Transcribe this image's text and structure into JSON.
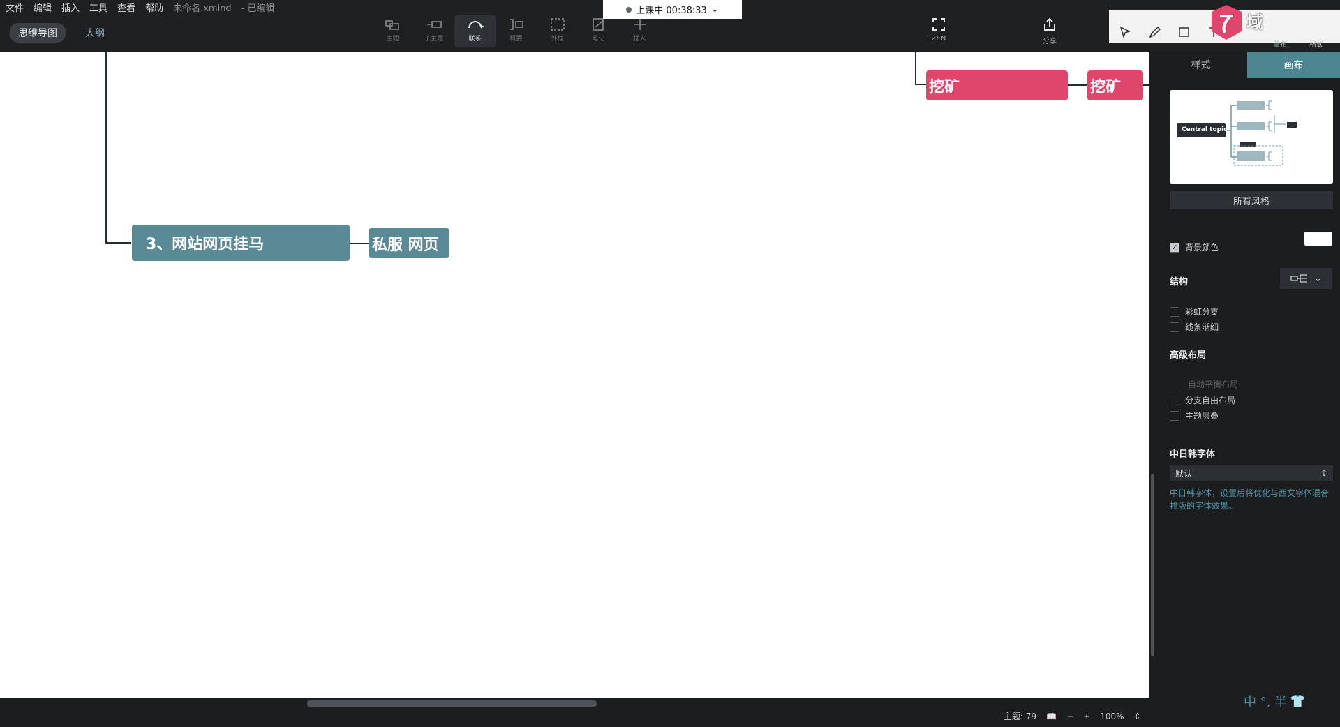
{
  "menu": {
    "items": [
      "文件",
      "编辑",
      "插入",
      "工具",
      "查看",
      "帮助"
    ],
    "filename": "未命名.xmind",
    "save_state": "- 已编辑"
  },
  "view_tabs": [
    "思维导图",
    "大纲"
  ],
  "toolbar": {
    "tools": [
      {
        "name": "subtopic",
        "label": "主题"
      },
      {
        "name": "sibling",
        "label": "子主题"
      },
      {
        "name": "relationship",
        "label": "联系"
      },
      {
        "name": "summary",
        "label": "概要"
      },
      {
        "name": "boundary",
        "label": "外框"
      },
      {
        "name": "note",
        "label": "笔记"
      },
      {
        "name": "insert",
        "label": "插入"
      }
    ],
    "active": "relationship"
  },
  "recording": {
    "status": "上课中 00:38:33"
  },
  "right_tools": {
    "zen": "ZEN",
    "share": "分享",
    "canvas_label": "画布",
    "format_label": "格式"
  },
  "brand": {
    "logo_text": "域"
  },
  "canvas": {
    "topics": {
      "main_branch": "3、网站网页挂马",
      "child": "私服 网页",
      "mining_1": "挖矿",
      "mining_2": "挖矿"
    }
  },
  "panel": {
    "tabs": [
      "样式",
      "画布"
    ],
    "active_tab": "画布",
    "preview_central": "Central topic",
    "all_styles": "所有风格",
    "bg_color_label": "背景颜色",
    "bg_color_checked": true,
    "structure_label": "结构",
    "rainbow_branch": "彩虹分支",
    "taper_lines": "线条渐细",
    "advanced_layout": "高级布局",
    "auto_balance": "自动平衡布局",
    "free_position": "分支自由布局",
    "topic_overlap": "主题层叠",
    "cjk_font_title": "中日韩字体",
    "cjk_font_value": "默认",
    "cjk_font_desc": "中日韩字体，设置后将优化与西文字体混合排版的字体效果。"
  },
  "status": {
    "topics": "主题: 79",
    "zoom": "100%"
  },
  "ime": {
    "text": "中 °, 半"
  },
  "colors": {
    "accent": "#4d8591",
    "topic_blue": "#5a8a95",
    "topic_pink": "#e0456b"
  }
}
